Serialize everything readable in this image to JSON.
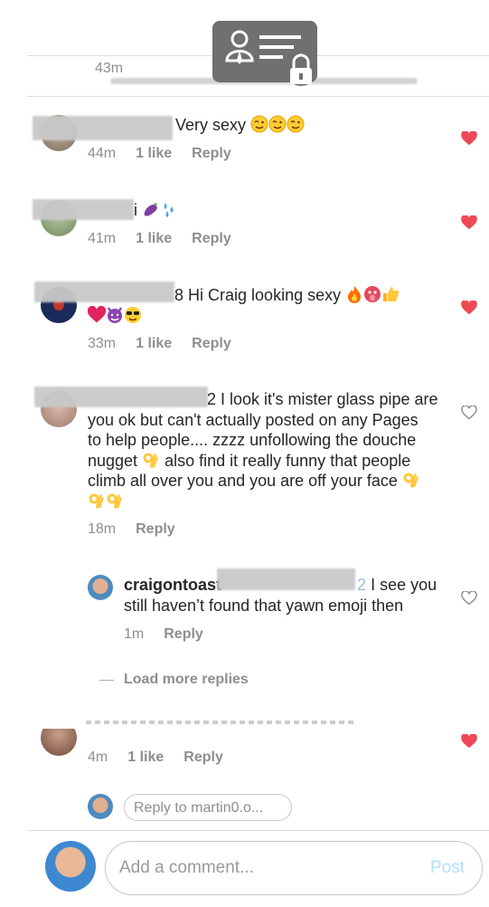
{
  "top": {
    "time": "43m"
  },
  "comments": [
    {
      "user_fragment": "dramos_71",
      "text": "Very sexy",
      "emojis": [
        "wink-face",
        "wink-face",
        "wink-face"
      ],
      "time": "44m",
      "likes": "1 like",
      "reply": "Reply",
      "liked": true
    },
    {
      "user_fragment": "i",
      "text": "",
      "emojis": [
        "eggplant",
        "sweat-droplets"
      ],
      "time": "41m",
      "likes": "1 like",
      "reply": "Reply",
      "liked": true
    },
    {
      "user_fragment": "8",
      "text": "Hi Craig looking sexy",
      "emojis": [
        "fire",
        "tongue-face",
        "thumbs-up"
      ],
      "emojis_line2": [
        "red-heart",
        "devil-face",
        "sunglasses-face"
      ],
      "time": "33m",
      "likes": "1 like",
      "reply": "Reply",
      "liked": true
    },
    {
      "user_fragment": "2",
      "line1": "I look it's mister glass pipe are",
      "line2": "you ok but can't actually posted on any Pages",
      "line3": "to help people.... zzzz unfollowing the douche",
      "line4": "nugget",
      "line4b": "also find it really funny that people",
      "line5": "climb all over you and you are off your face",
      "time": "18m",
      "reply": "Reply",
      "liked": false
    },
    {
      "user_fragment": "martin0.o",
      "time": "4m",
      "likes": "1 like",
      "reply": "Reply",
      "liked": true
    }
  ],
  "reply": {
    "username": "craigontoast",
    "mention_fragment": "2",
    "line1": "I see you",
    "line2": "still haven’t found that yawn emoji then",
    "time": "1m",
    "reply": "Reply"
  },
  "load_more": "Load more replies",
  "reply_input": {
    "placeholder": "Reply to martin0.o..."
  },
  "comment_input": {
    "placeholder": "Add a comment...",
    "post": "Post"
  },
  "colors": {
    "heart": "#ed4956",
    "post": "#b2dffc",
    "secondary": "#8e8e8e"
  }
}
